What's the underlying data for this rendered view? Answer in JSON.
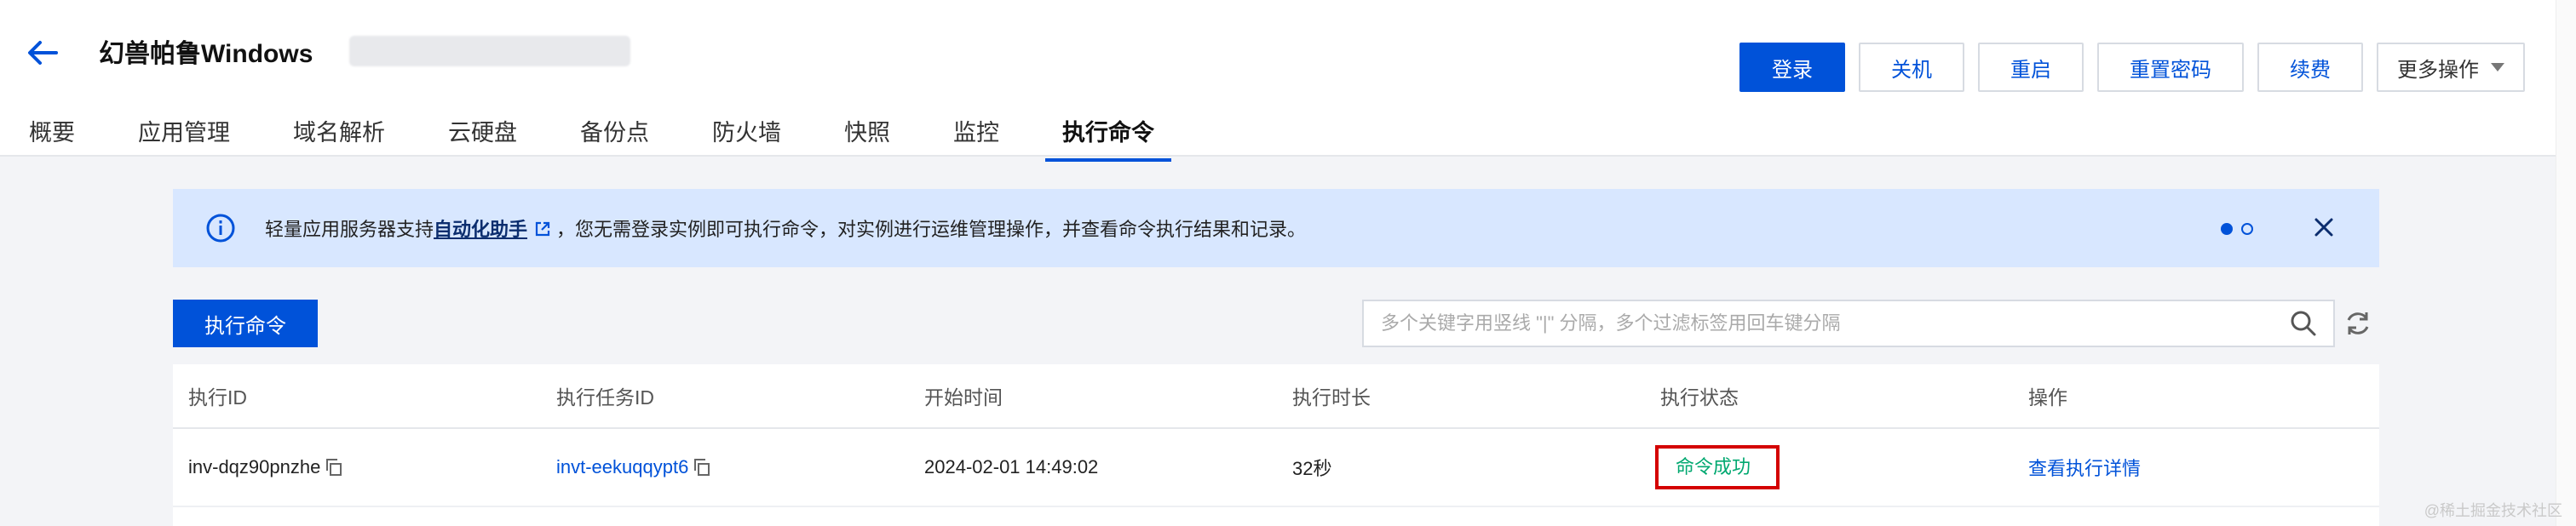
{
  "header": {
    "title": "幻兽帕鲁Windows",
    "actions": {
      "login": "登录",
      "shutdown": "关机",
      "restart": "重启",
      "reset_password": "重置密码",
      "renew": "续费",
      "more": "更多操作"
    }
  },
  "tabs": [
    "概要",
    "应用管理",
    "域名解析",
    "云硬盘",
    "备份点",
    "防火墙",
    "快照",
    "监控",
    "执行命令"
  ],
  "active_tab": "执行命令",
  "notice": {
    "prefix": "轻量应用服务器支持",
    "link": "自动化助手",
    "suffix": "，您无需登录实例即可执行命令，对实例进行运维管理操作，并查看命令执行结果和记录。"
  },
  "toolbar": {
    "run_button": "执行命令",
    "search_placeholder": "多个关键字用竖线 \"|\" 分隔，多个过滤标签用回车键分隔"
  },
  "table": {
    "headers": [
      "执行ID",
      "执行任务ID",
      "开始时间",
      "执行时长",
      "执行状态",
      "操作"
    ],
    "rows": [
      {
        "exec_id": "inv-dqz90pnzhe",
        "task_id": "invt-eekuqqypt6",
        "start_time": "2024-02-01 14:49:02",
        "duration": "32秒",
        "status": "命令成功",
        "action": "查看执行详情"
      }
    ]
  },
  "watermark": "@稀土掘金技术社区",
  "colors": {
    "primary": "#0052d9",
    "success": "#00a870",
    "highlight": "#d40000",
    "notice_bg": "#d8e7ff"
  }
}
